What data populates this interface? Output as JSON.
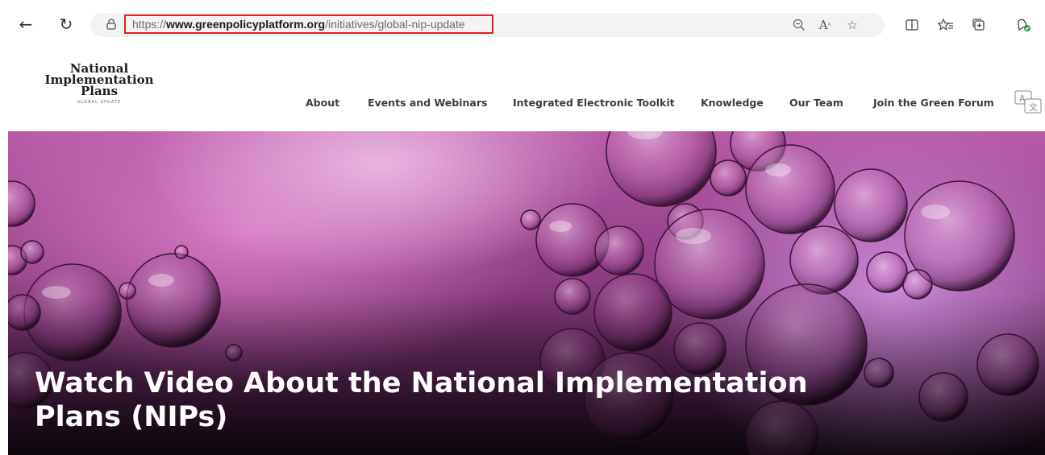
{
  "browser": {
    "url_scheme": "https://",
    "url_domain": "www.greenpolicyplatform.org",
    "url_path": "/initiatives/global-nip-update",
    "icons": {
      "back": "back-arrow-icon",
      "refresh": "refresh-icon",
      "lock": "lock-icon",
      "zoom": "zoom-out-icon",
      "read_aloud": "read-aloud-icon",
      "favorite": "favorite-star-icon",
      "split": "split-screen-icon",
      "favorites": "favorites-list-icon",
      "collections": "collections-icon",
      "extensions": "extension-icon"
    },
    "highlight_color": "#e0201c"
  },
  "site": {
    "logo": {
      "line1": "National",
      "line2": "Implementation",
      "line3": "Plans",
      "subtitle": "GLOBAL UPDATE"
    },
    "nav": [
      {
        "label": "About"
      },
      {
        "label": "Events and Webinars"
      },
      {
        "label": "Integrated Electronic Toolkit"
      },
      {
        "label": "Knowledge"
      },
      {
        "label": "Our Team"
      },
      {
        "label": "Join the Green Forum"
      }
    ],
    "translate_icon": "translate-icon"
  },
  "hero": {
    "title_line1": "Watch Video About the National Implementation",
    "title_line2": "Plans (NIPs)"
  }
}
